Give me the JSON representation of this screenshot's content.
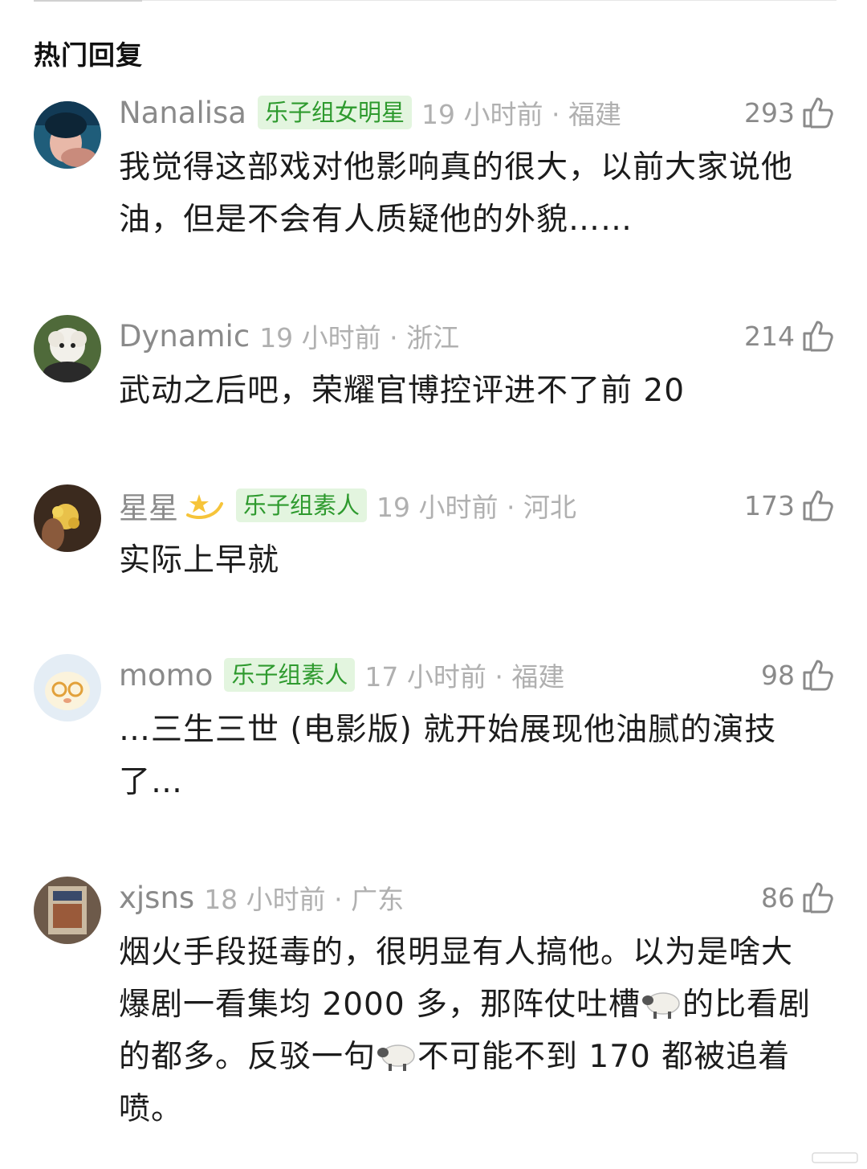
{
  "section": {
    "title": "热门回复"
  },
  "comments": [
    {
      "username": "Nanalisa",
      "badge": "乐子组女明星",
      "time_location": "19 小时前 · 福建",
      "likes": "293",
      "text": "我觉得这部戏对他影响真的很大，以前大家说他油，但是不会有人质疑他的外貌……"
    },
    {
      "username": "Dynamic",
      "badge": "",
      "time_location": "19 小时前 · 浙江",
      "likes": "214",
      "text": "武动之后吧，荣耀官博控评进不了前 20"
    },
    {
      "username": "星星",
      "badge": "乐子组素人",
      "time_location": "19 小时前 · 河北",
      "likes": "173",
      "text": "实际上早就"
    },
    {
      "username": "momo",
      "badge": "乐子组素人",
      "time_location": "17 小时前 · 福建",
      "likes": "98",
      "text": "…三生三世 (电影版) 就开始展现他油腻的演技了…"
    },
    {
      "username": "xjsns",
      "badge": "",
      "time_location": "18 小时前 · 广东",
      "likes": "86",
      "text_parts": [
        "烟火手段挺毒的，很明显有人搞他。以为是啥大爆剧一看集均 2000 多，那阵仗吐槽",
        "的比看剧的都多。反驳一句",
        "不可能不到 170 都被追着喷。"
      ]
    }
  ],
  "icons": {
    "like": "thumbs-up-icon",
    "star_emoji": "dizzy-star-icon",
    "sheep_emoji": "sheep-icon"
  },
  "colors": {
    "badge_bg": "#e3f5df",
    "badge_text": "#2e9a2e",
    "meta_gray": "#b0b0b0"
  }
}
